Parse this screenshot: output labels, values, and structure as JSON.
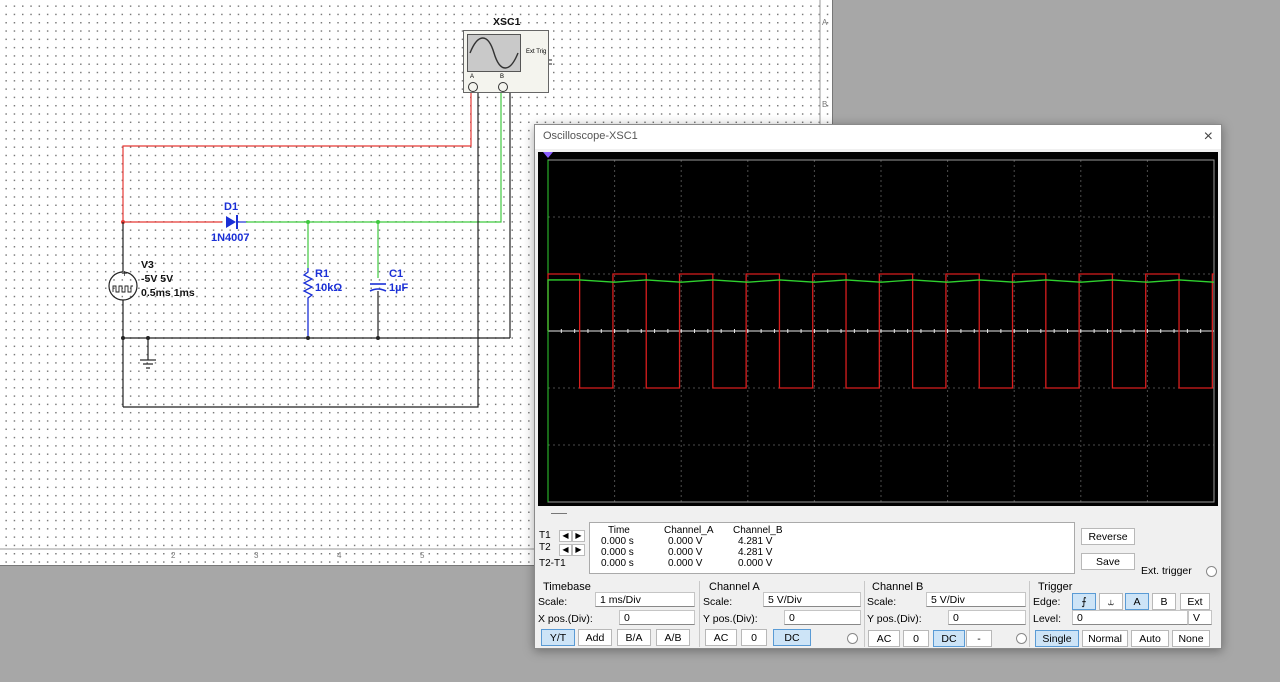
{
  "schematic": {
    "instrument": {
      "ref": "XSC1",
      "ext_trig": "Ext Trig",
      "pin_a": "A",
      "pin_b": "B"
    },
    "diode": {
      "ref": "D1",
      "model": "1N4007"
    },
    "source": {
      "ref": "V3",
      "values": "-5V 5V",
      "timing": "0.5ms 1ms"
    },
    "resistor": {
      "ref": "R1",
      "value": "10kΩ"
    },
    "capacitor": {
      "ref": "C1",
      "value": "1µF"
    },
    "ruler_marks": [
      "2",
      "3",
      "4",
      "5",
      "6",
      "7",
      "8"
    ],
    "side_marks": [
      "A",
      "B"
    ]
  },
  "colors": {
    "wire_a": "#e53935",
    "wire_b": "#3fc93f",
    "wire": "#222222",
    "component": "#1a2fd6",
    "trace_a": "#d81e1e",
    "trace_b": "#2fd12f",
    "grid": "#4d4d4d"
  },
  "oscilloscope": {
    "title": "Oscilloscope-XSC1",
    "close": "×",
    "readout": {
      "headers": [
        "Time",
        "Channel_A",
        "Channel_B"
      ],
      "rows": [
        {
          "label": "T1",
          "time": "0.000 s",
          "a": "0.000 V",
          "b": "4.281 V"
        },
        {
          "label": "T2",
          "time": "0.000 s",
          "a": "0.000 V",
          "b": "4.281 V"
        },
        {
          "label": "T2-T1",
          "time": "0.000 s",
          "a": "0.000 V",
          "b": "0.000 V"
        }
      ]
    },
    "reverse_label": "Reverse",
    "save_label": "Save",
    "ext_trigger_label": "Ext. trigger",
    "timebase": {
      "title": "Timebase",
      "scale_label": "Scale:",
      "scale": "1 ms/Div",
      "xpos_label": "X pos.(Div):",
      "xpos": "0",
      "modes": [
        "Y/T",
        "Add",
        "B/A",
        "A/B"
      ],
      "selected": "Y/T"
    },
    "channel_a": {
      "title": "Channel A",
      "scale_label": "Scale:",
      "scale": "5  V/Div",
      "ypos_label": "Y pos.(Div):",
      "ypos": "0",
      "coupling": [
        "AC",
        "0",
        "DC"
      ],
      "selected": "DC"
    },
    "channel_b": {
      "title": "Channel B",
      "scale_label": "Scale:",
      "scale": "5  V/Div",
      "ypos_label": "Y pos.(Div):",
      "ypos": "0",
      "coupling": [
        "AC",
        "0",
        "DC",
        "-"
      ],
      "selected": "DC"
    },
    "trigger": {
      "title": "Trigger",
      "edge_label": "Edge:",
      "edge_rise": "⨍",
      "edge_fall": "⥿",
      "sources": [
        "A",
        "B",
        "Ext"
      ],
      "selected_source": "A",
      "level_label": "Level:",
      "level": "0",
      "level_unit": "V",
      "modes": [
        "Single",
        "Normal",
        "Auto",
        "None"
      ],
      "selected_mode": "Single"
    }
  },
  "chart_data": {
    "type": "line",
    "divisions": {
      "x": 10,
      "y": 6
    },
    "timebase_ms_per_div": 1,
    "volts_per_div": {
      "A": 5,
      "B": 5
    },
    "series": [
      {
        "name": "Channel_A",
        "waveform": "square",
        "period_ms": 1,
        "high_v": 5,
        "low_v": -5
      },
      {
        "name": "Channel_B",
        "waveform": "rectified ripple",
        "level_v": 4.281,
        "ripple_v": 0.2
      }
    ]
  }
}
